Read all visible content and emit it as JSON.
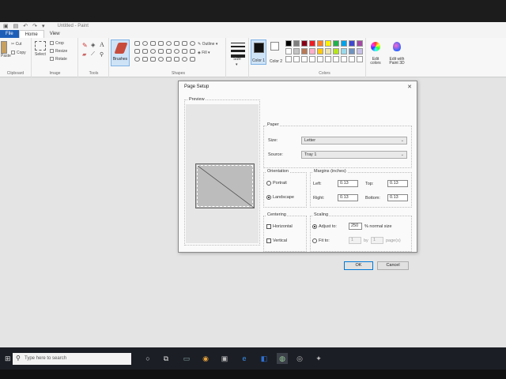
{
  "window": {
    "title": "Untitled - Paint"
  },
  "tabs": {
    "file": "File",
    "home": "Home",
    "view": "View"
  },
  "ribbon": {
    "clipboard": {
      "paste": "Paste",
      "cut": "Cut",
      "copy": "Copy",
      "label": "Clipboard"
    },
    "image": {
      "select": "Select",
      "crop": "Crop",
      "resize": "Resize",
      "rotate": "Rotate",
      "label": "Image"
    },
    "tools": {
      "label": "Tools"
    },
    "brushes": {
      "label": "Brushes"
    },
    "shapes": {
      "outline": "Outline",
      "fill": "Fill",
      "label": "Shapes"
    },
    "size": {
      "label": "Size"
    },
    "color1": {
      "label": "Color 1"
    },
    "color2": {
      "label": "Color 2"
    },
    "colors": {
      "label": "Colors",
      "palette": [
        "#000000",
        "#7f7f7f",
        "#880015",
        "#ed1c24",
        "#ff7f27",
        "#fff200",
        "#22b14c",
        "#00a2e8",
        "#3f48cc",
        "#a349a4",
        "#ffffff",
        "#c3c3c3",
        "#b97a57",
        "#ffaec9",
        "#ffc90e",
        "#efe4b0",
        "#b5e61d",
        "#99d9ea",
        "#7092be",
        "#c8bfe7",
        "#ffffff",
        "#ffffff",
        "#ffffff",
        "#ffffff",
        "#ffffff",
        "#ffffff",
        "#ffffff",
        "#ffffff",
        "#ffffff",
        "#ffffff"
      ]
    },
    "edit_colors": "Edit colors",
    "edit_paint3d": "Edit with Paint 3D"
  },
  "dialog": {
    "title": "Page Setup",
    "preview_label": "Preview",
    "paper": {
      "label": "Paper",
      "size_label": "Size:",
      "size_value": "Letter",
      "source_label": "Source:",
      "source_value": "Tray 1"
    },
    "orientation": {
      "label": "Orientation",
      "portrait": "Portrait",
      "landscape": "Landscape",
      "selected": "landscape"
    },
    "margins": {
      "label": "Margins (inches)",
      "left_label": "Left:",
      "left": "0.13",
      "top_label": "Top:",
      "top": "0.13",
      "right_label": "Right:",
      "right": "0.13",
      "bottom_label": "Bottom:",
      "bottom": "0.13"
    },
    "centering": {
      "label": "Centering",
      "horizontal": "Horizontal",
      "vertical": "Vertical"
    },
    "scaling": {
      "label": "Scaling",
      "adjust_to": "Adjust to:",
      "adjust_value": "250",
      "adjust_suffix": "% normal size",
      "fit_to": "Fit to:",
      "fit_w": "1",
      "by": "by",
      "fit_h": "1",
      "pages": "page(s)"
    },
    "ok": "OK",
    "cancel": "Cancel"
  },
  "taskbar": {
    "search_placeholder": "Type here to search"
  }
}
